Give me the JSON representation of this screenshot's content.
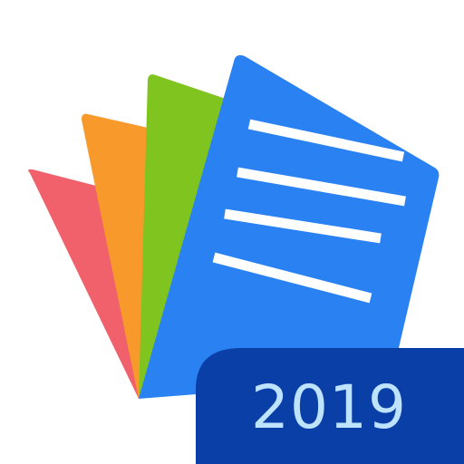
{
  "badge": {
    "year": "2019"
  },
  "colors": {
    "background": "#ffffff",
    "sheet_red": "#f0616b",
    "sheet_orange": "#f89a2b",
    "sheet_green": "#7fc41f",
    "sheet_blue": "#2a81f2",
    "lines": "#ffffff",
    "badge_background": "#0b3fa8",
    "badge_text": "#bde3ff"
  }
}
